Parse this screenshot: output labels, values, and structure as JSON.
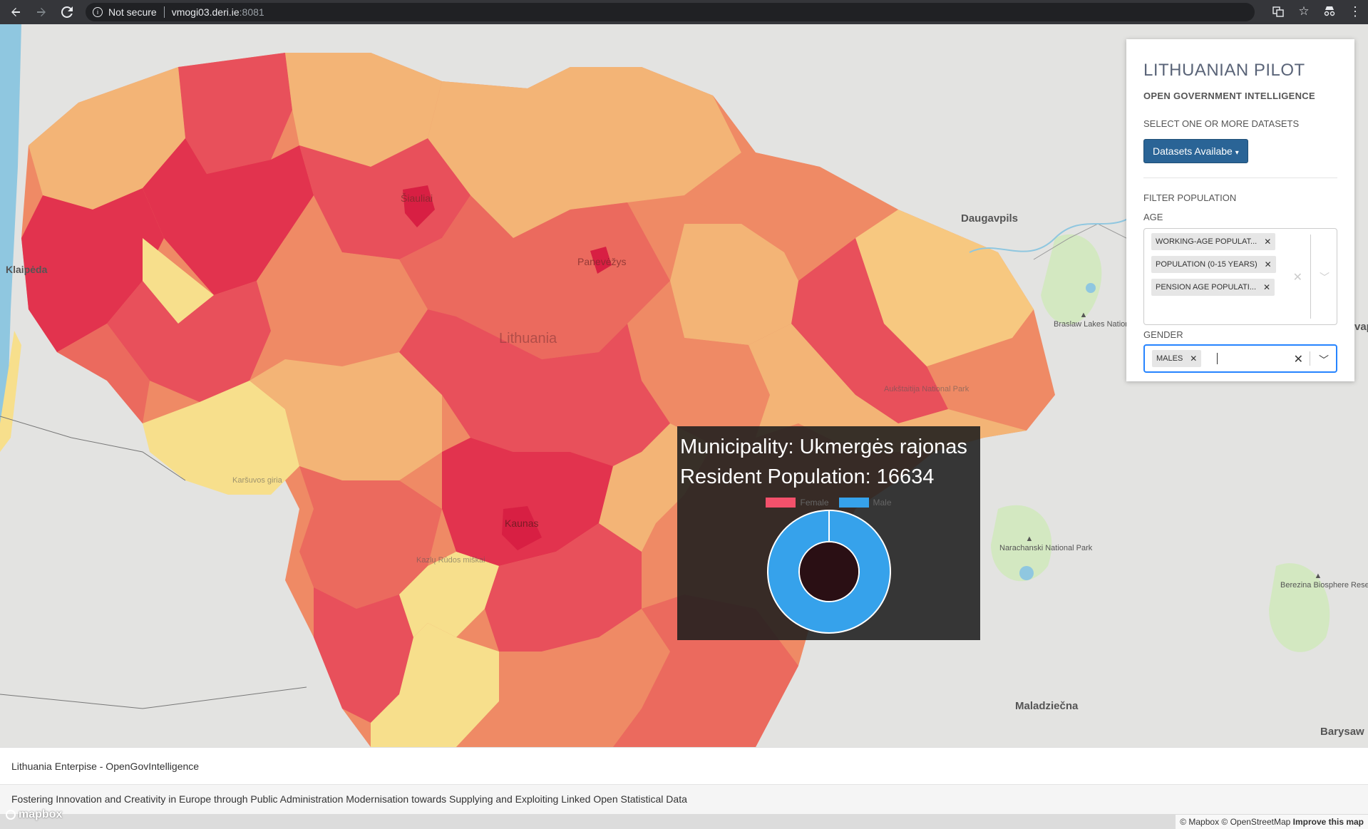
{
  "browser": {
    "security_label": "Not secure",
    "host": "vmogi03.deri.ie",
    "port": ":8081"
  },
  "map": {
    "country_label": "Lithuania",
    "cities": [
      "Šiauliai",
      "Panevėžys",
      "Kaunas",
      "Klaipėda",
      "Daugavpils",
      "Maladziečna",
      "Barysaw"
    ],
    "parks": [
      "Braslaw Lakes National Park",
      "Narachanski National Park",
      "Berezina Biosphere Reserve",
      "Aukštaitija National Park",
      "Kazlų Rūdos miškai",
      "Karšuvos giria"
    ],
    "edge_label": "vap",
    "colors": {
      "dark_red": "#e2334e",
      "red": "#e8505b",
      "red_orange": "#eb6a5e",
      "orange": "#ef8a65",
      "light_orange": "#f3b476",
      "yellow": "#f7df8c",
      "water": "#8fc7e0",
      "land": "#e3e3e1"
    }
  },
  "tooltip": {
    "municipality_line": "Municipality: Ukmergės rajonas",
    "population_line": "Resident Population: 16634",
    "legend": {
      "female": "Female",
      "male": "Male"
    },
    "female_color": "#f3516b",
    "male_color": "#36a2eb"
  },
  "chart_data": {
    "type": "pie",
    "categories": [
      "Female",
      "Male"
    ],
    "values": [
      0,
      16634
    ],
    "colors": [
      "#f3516b",
      "#36a2eb"
    ],
    "donut": true
  },
  "panel": {
    "title": "LITHUANIAN PILOT",
    "subtitle": "OPEN GOVERNMENT INTELLIGENCE",
    "hint": "SELECT ONE OR MORE DATASETS",
    "datasets_button": "Datasets Availabe",
    "filter_label": "FILTER POPULATION",
    "age_label": "AGE",
    "age_chips": [
      "WORKING-AGE POPULAT...",
      "POPULATION (0-15 YEARS)",
      "PENSION AGE POPULATI..."
    ],
    "gender_label": "GENDER",
    "gender_chips": [
      "MALES"
    ]
  },
  "footer": {
    "line1": "Lithuania Enterpise - OpenGovIntelligence",
    "line2": "Fostering Innovation and Creativity in Europe through Public Administration Modernisation towards Supplying and Exploiting Linked Open Statistical Data",
    "mapbox_logo": "mapbox",
    "attribution": "© Mapbox © OpenStreetMap",
    "improve": "Improve this map"
  }
}
